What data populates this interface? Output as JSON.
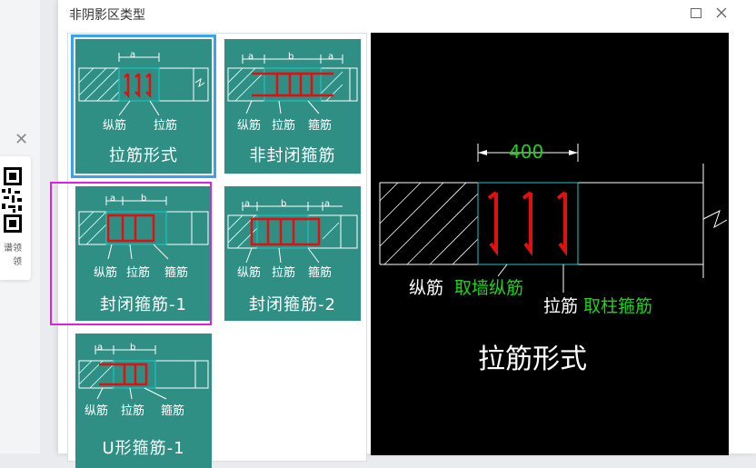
{
  "dialog": {
    "title": "非阴影区类型",
    "maximize_label": "☐",
    "close_label": "✕"
  },
  "side_panel": {
    "close_label": "✕",
    "qr_text_line1": "谱领",
    "qr_text_line2": "领"
  },
  "tiles": [
    {
      "label": "拉筋形式",
      "dims": [
        "a"
      ],
      "notes": [
        "纵筋",
        "拉筋"
      ],
      "selected": true
    },
    {
      "label": "非封闭箍筋",
      "dims": [
        "a",
        "b",
        "a"
      ],
      "notes": [
        "纵筋",
        "拉筋",
        "箍筋"
      ],
      "selected": false
    },
    {
      "label": "封闭箍筋-1",
      "dims": [
        "a",
        "b"
      ],
      "notes": [
        "纵筋",
        "拉筋",
        "箍筋"
      ],
      "selected": false
    },
    {
      "label": "封闭箍筋-2",
      "dims": [
        "a",
        "b",
        "a"
      ],
      "notes": [
        "纵筋",
        "拉筋",
        "箍筋"
      ],
      "selected": false
    },
    {
      "label": "U形箍筋-1",
      "dims": [
        "a",
        "b"
      ],
      "notes": [
        "纵筋",
        "拉筋",
        "箍筋"
      ],
      "selected": false
    }
  ],
  "preview": {
    "dimension": "400",
    "label_rebar": "纵筋",
    "label_rebar_value": "取墙纵筋",
    "label_tie": "拉筋",
    "label_tie_value": "取柱箍筋",
    "caption": "拉筋形式"
  },
  "colors": {
    "tile_bg": "#2f8f84",
    "selected_border": "#3aa0f0",
    "highlight_border": "#e020e0",
    "rebar_red": "#e01010",
    "cad_green": "#19d619",
    "cad_cyan": "#19c8c8"
  }
}
